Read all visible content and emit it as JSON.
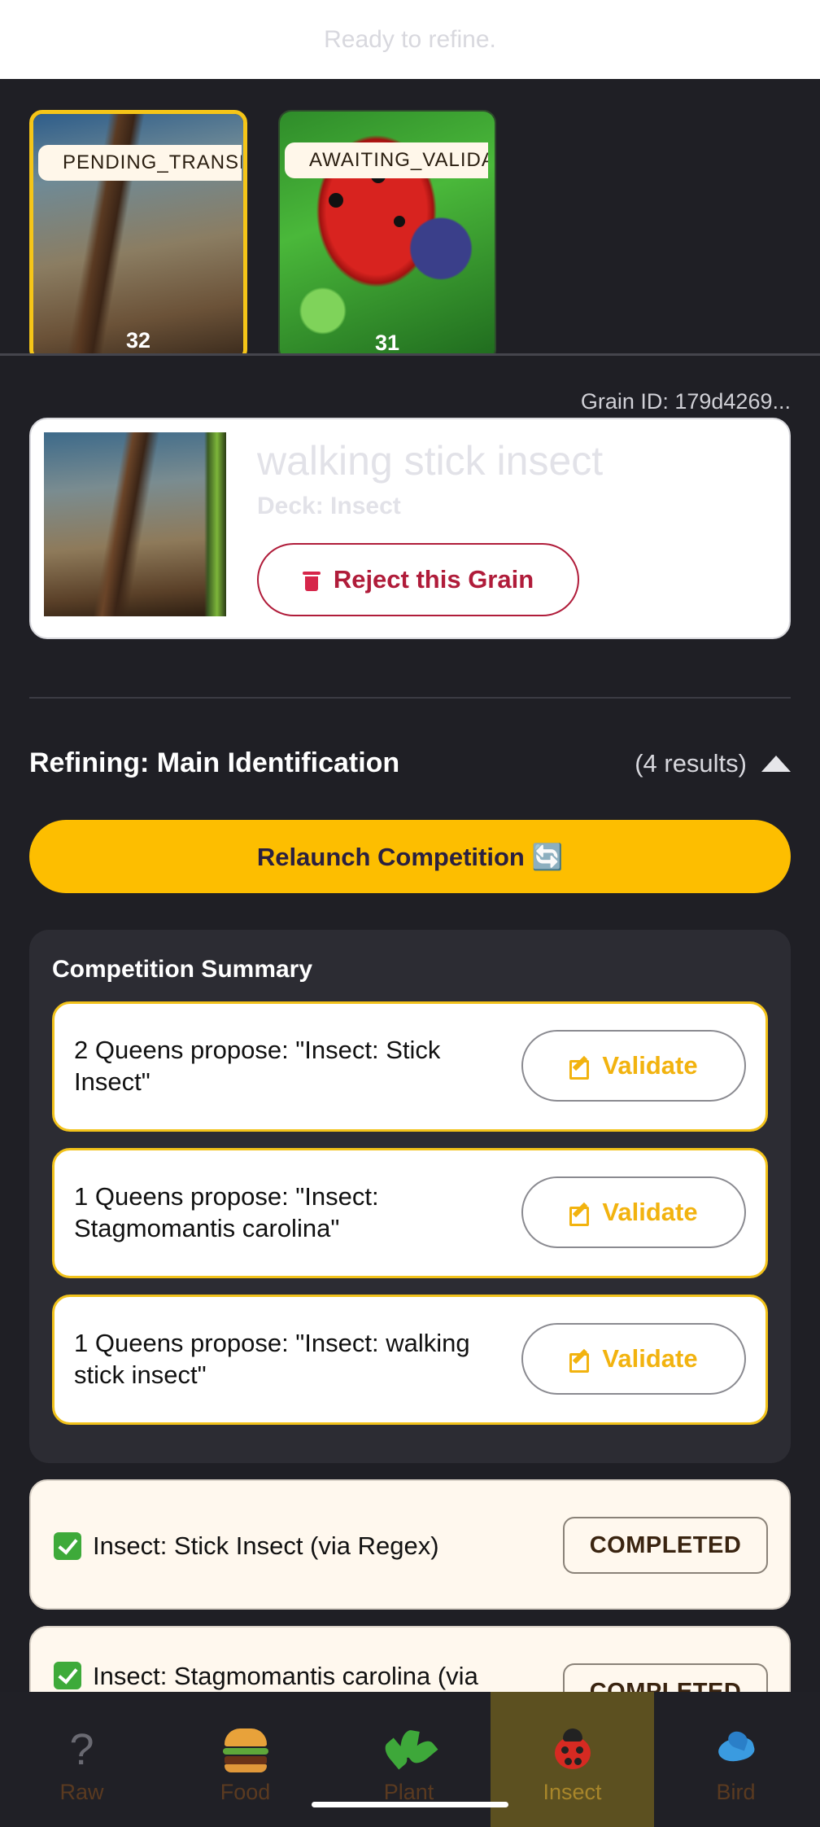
{
  "top_status": "Ready to refine.",
  "thumbnails": [
    {
      "status": "PENDING_TRANSLATION",
      "count": "32",
      "selected": true
    },
    {
      "status": "AWAITING_VALIDATION",
      "count": "31",
      "selected": false
    }
  ],
  "grain": {
    "id_label": "Grain ID: 179d4269...",
    "title": "walking stick insect",
    "deck": "Deck: Insect",
    "reject_label": "Reject this Grain"
  },
  "refining": {
    "title": "Refining: Main Identification",
    "results": "(4 results)",
    "relaunch_label": "Relaunch Competition 🔄"
  },
  "summary": {
    "title": "Competition Summary",
    "proposals": [
      {
        "text": "2 Queens propose: \"Insect: Stick Insect\"",
        "button": "Validate"
      },
      {
        "text": "1 Queens propose: \"Insect: Stagmomantis carolina\"",
        "button": "Validate"
      },
      {
        "text": "1 Queens propose: \"Insect: walking stick insect\"",
        "button": "Validate"
      }
    ]
  },
  "completed_items": [
    {
      "text": "Insect: Stick Insect (via Regex)",
      "status": "COMPLETED"
    },
    {
      "text": "Insect: Stagmomantis carolina (via",
      "status": "COMPLETED"
    }
  ],
  "nav": {
    "items": [
      {
        "label": "Raw",
        "icon": "question-icon"
      },
      {
        "label": "Food",
        "icon": "burger-icon"
      },
      {
        "label": "Plant",
        "icon": "herb-icon"
      },
      {
        "label": "Insect",
        "icon": "ladybug-icon"
      },
      {
        "label": "Bird",
        "icon": "bird-icon"
      }
    ],
    "active": "Insect"
  }
}
